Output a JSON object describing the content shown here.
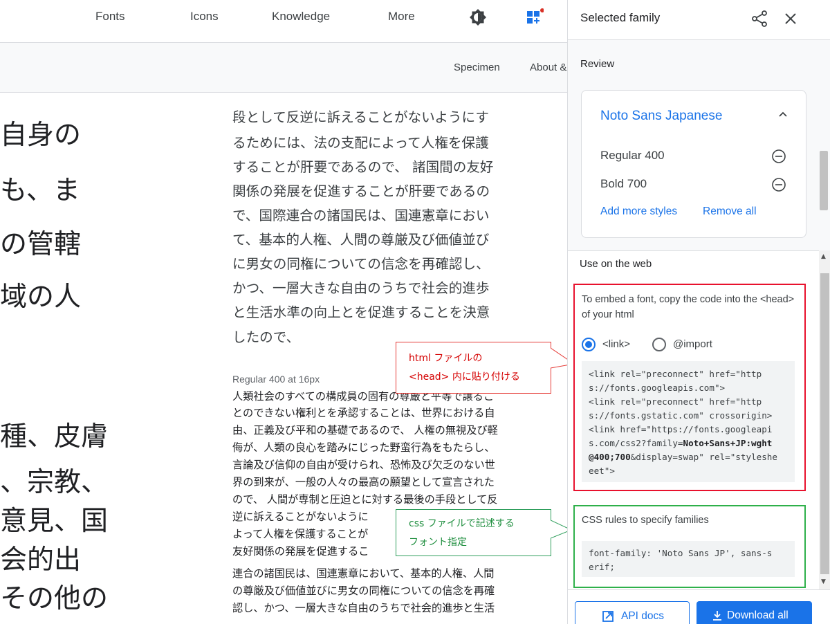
{
  "nav": {
    "fonts": "Fonts",
    "icons": "Icons",
    "knowledge": "Knowledge",
    "more": "More",
    "specimen": "Specimen",
    "about": "About &"
  },
  "big_text": [
    "自身の",
    "も、ま",
    "の管轄",
    "域の人",
    "種、皮膚",
    "、宗教、",
    "意見、国",
    "会的出",
    "その他の"
  ],
  "mid_text": [
    "段として反逆に訴えることがないようにす",
    "るためには、法の支配によって人権を保護",
    "することが肝要であるので、 諸国間の友好",
    "関係の発展を促進することが肝要であるの",
    "で、国際連合の諸国民は、国連憲章におい",
    "て、基本的人権、人間の尊厳及び価値並び",
    "に男女の同権についての信念を再確認し、",
    "かつ、一層大きな自由のうちで社会的進歩",
    "と生活水準の向上とを促進することを決意",
    "したので、"
  ],
  "specimen_label": "Regular 400 at 16px",
  "small_text": [
    "人類社会のすべての構成員の固有の尊厳と平等で譲るこ",
    "とのできない権利とを承認することは、世界における自",
    "由、正義及び平和の基礎であるので、 人権の無視及び軽",
    "侮が、人類の良心を踏みにじった野蛮行為をもたらし、",
    "言論及び信仰の自由が受けられ、恐怖及び欠乏のない世",
    "界の到来が、一般の人々の最高の願望として宣言された",
    "ので、 人間が専制と圧迫とに対する最後の手段として反",
    "逆に訴えることがないように",
    "よって人権を保護することが",
    "友好関係の発展を促進するこ",
    "連合の諸国民は、国連憲章において、基本的人権、人間",
    "の尊厳及び価値並びに男女の同権についての信念を再確",
    "認し、かつ、一層大きな自由のうちで社会的進歩と生活"
  ],
  "callouts": {
    "red": [
      "html ファイルの",
      "<head> 内に貼り付ける"
    ],
    "green": [
      "css ファイルで記述する",
      "フォント指定"
    ]
  },
  "panel": {
    "title": "Selected family",
    "review": "Review",
    "family_name": "Noto Sans Japanese",
    "styles": [
      "Regular 400",
      "Bold 700"
    ],
    "add_more": "Add more styles",
    "remove_all": "Remove all",
    "use_on_web": "Use on the web",
    "embed_text": "To embed a font, copy the code into the <head> of your html",
    "radio_link": "<link>",
    "radio_import": "@import",
    "code_lines": [
      "<link rel=\"preconnect\" href=\"http",
      "s://fonts.googleapis.com\">",
      "<link rel=\"preconnect\" href=\"http",
      "s://fonts.gstatic.com\" crossorigin>",
      "<link href=\"https://fonts.googleapi",
      "s.com/css2?family=",
      "Noto+Sans+JP:wght",
      "@400;700",
      "&display=swap\" rel=\"styleshe",
      "eet\">"
    ],
    "css_title": "CSS rules to specify families",
    "css_lines": [
      "font-family: 'Noto Sans JP', sans-s",
      "erif;"
    ],
    "api_docs": "API docs",
    "download_all": "Download all"
  },
  "colors": {
    "accent": "#1a73e8",
    "red_annotation": "#e8112d",
    "green_annotation": "#2eb04a"
  }
}
